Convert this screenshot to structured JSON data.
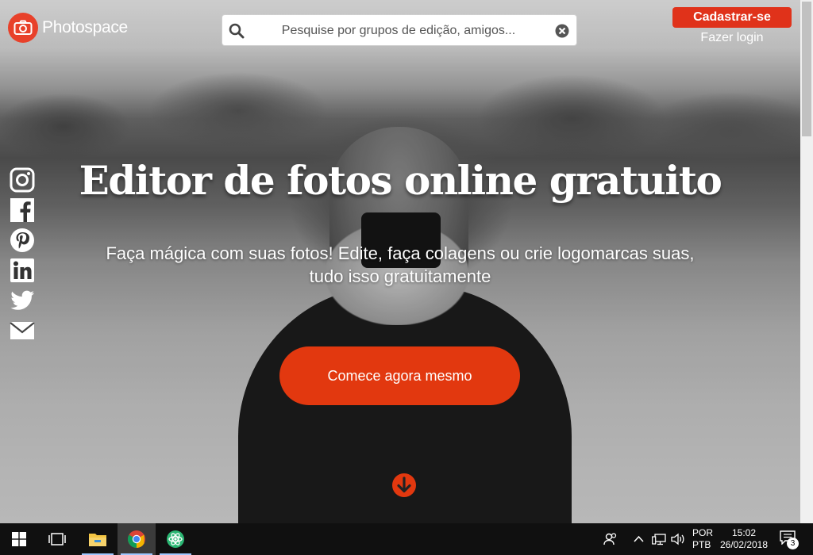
{
  "header": {
    "logo_text": "Photospace",
    "search": {
      "placeholder": "Pesquise por grupos de edição, amigos..."
    },
    "signup_label": "Cadastrar-se",
    "login_label": "Fazer login"
  },
  "social": [
    {
      "name": "instagram-icon"
    },
    {
      "name": "facebook-icon"
    },
    {
      "name": "pinterest-icon"
    },
    {
      "name": "linkedin-icon"
    },
    {
      "name": "twitter-icon"
    },
    {
      "name": "email-icon"
    }
  ],
  "hero": {
    "title": "Editor de fotos online gratuito",
    "subtitle": "Faça mágica com suas fotos! Edite, faça colagens ou crie logomarcas suas, tudo isso gratuitamente",
    "cta_label": "Comece agora mesmo"
  },
  "colors": {
    "accent": "#e2380f",
    "signup": "#e0321a",
    "logo": "#e8412a"
  },
  "taskbar": {
    "language": "POR",
    "keyboard": "PTB",
    "time": "15:02",
    "date": "26/02/2018",
    "notifications": "3"
  }
}
